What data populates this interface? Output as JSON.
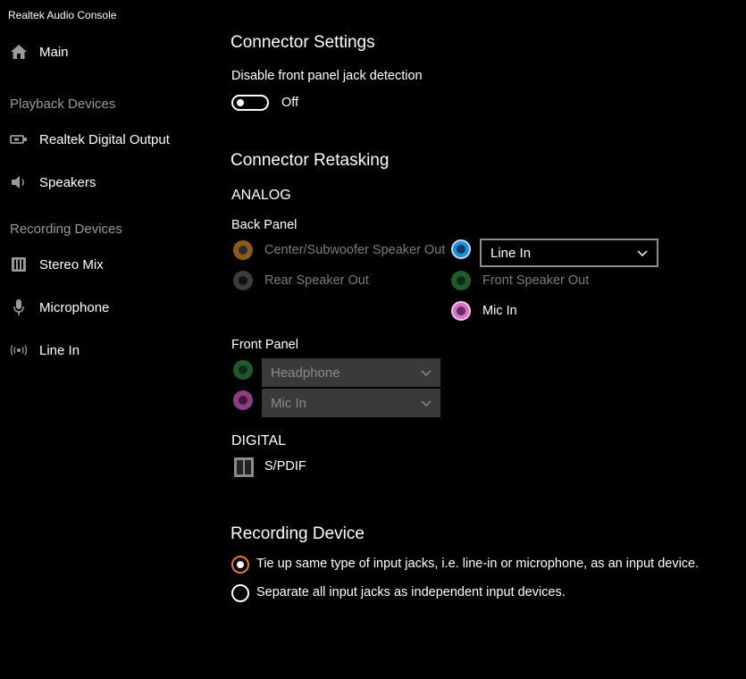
{
  "app": {
    "title": "Realtek Audio Console"
  },
  "sidebar": {
    "main": {
      "label": "Main",
      "icon": "home-icon"
    },
    "playback_header": "Playback Devices",
    "playback": [
      {
        "label": "Realtek Digital Output",
        "icon": "digital-output-icon"
      },
      {
        "label": "Speakers",
        "icon": "speaker-icon"
      }
    ],
    "recording_header": "Recording Devices",
    "recording": [
      {
        "label": "Stereo Mix",
        "icon": "stereo-mix-icon"
      },
      {
        "label": "Microphone",
        "icon": "microphone-icon"
      },
      {
        "label": "Line In",
        "icon": "line-in-icon"
      }
    ]
  },
  "connector_settings": {
    "title": "Connector Settings",
    "jack_detection_label": "Disable front panel jack detection",
    "toggle_state": "Off"
  },
  "retasking": {
    "title": "Connector Retasking",
    "analog_label": "ANALOG",
    "back_panel_label": "Back Panel",
    "back_jacks": [
      {
        "label": "Center/Subwoofer Speaker Out",
        "color": "#8a5a1e",
        "enabled": false
      },
      {
        "label": "Rear Speaker Out",
        "color": "#3c3c3c",
        "enabled": false
      },
      {
        "label": "Line In",
        "color": "#1f8fd8",
        "enabled": true
      },
      {
        "label": "Front Speaker Out",
        "color": "#1f5a2c",
        "enabled": false
      },
      {
        "label": "Mic In",
        "color": "#d86fc8",
        "enabled": true
      }
    ],
    "line_in_dropdown_value": "Line In",
    "front_panel_label": "Front Panel",
    "front_jacks": [
      {
        "value": "Headphone",
        "color": "#1f5a2c"
      },
      {
        "value": "Mic In",
        "color": "#8a3f84"
      }
    ],
    "digital_label": "DIGITAL",
    "spdif_label": "S/PDIF"
  },
  "recording_device": {
    "title": "Recording Device",
    "options": [
      {
        "label": "Tie up same type of input jacks, i.e. line-in or microphone, as an input device.",
        "selected": true
      },
      {
        "label": "Separate all input jacks as independent input devices.",
        "selected": false
      }
    ]
  },
  "colors": {
    "radio_accent": "#e27a3f",
    "background": "#000000"
  }
}
